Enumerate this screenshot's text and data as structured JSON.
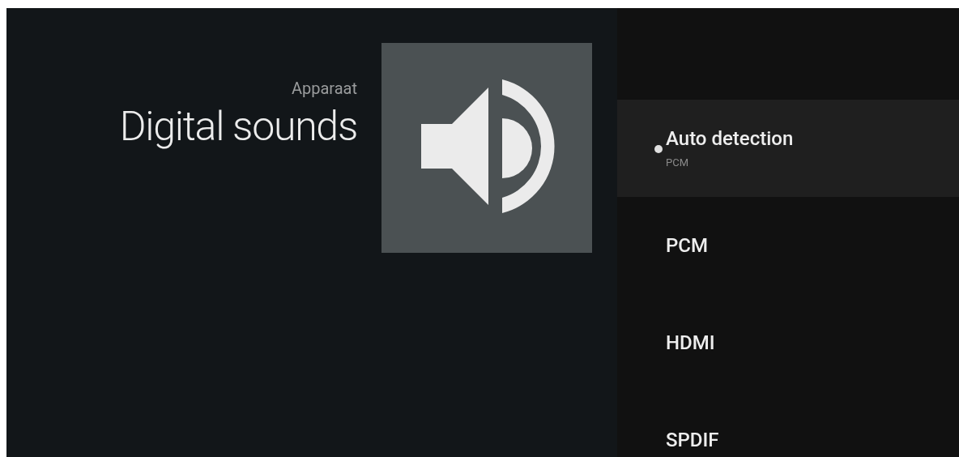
{
  "header": {
    "breadcrumb": "Apparaat",
    "title": "Digital sounds"
  },
  "options": [
    {
      "label": "Auto detection",
      "summary": "PCM",
      "selected": true
    },
    {
      "label": "PCM",
      "selected": false
    },
    {
      "label": "HDMI",
      "selected": false
    },
    {
      "label": "SPDIF",
      "selected": false
    }
  ]
}
